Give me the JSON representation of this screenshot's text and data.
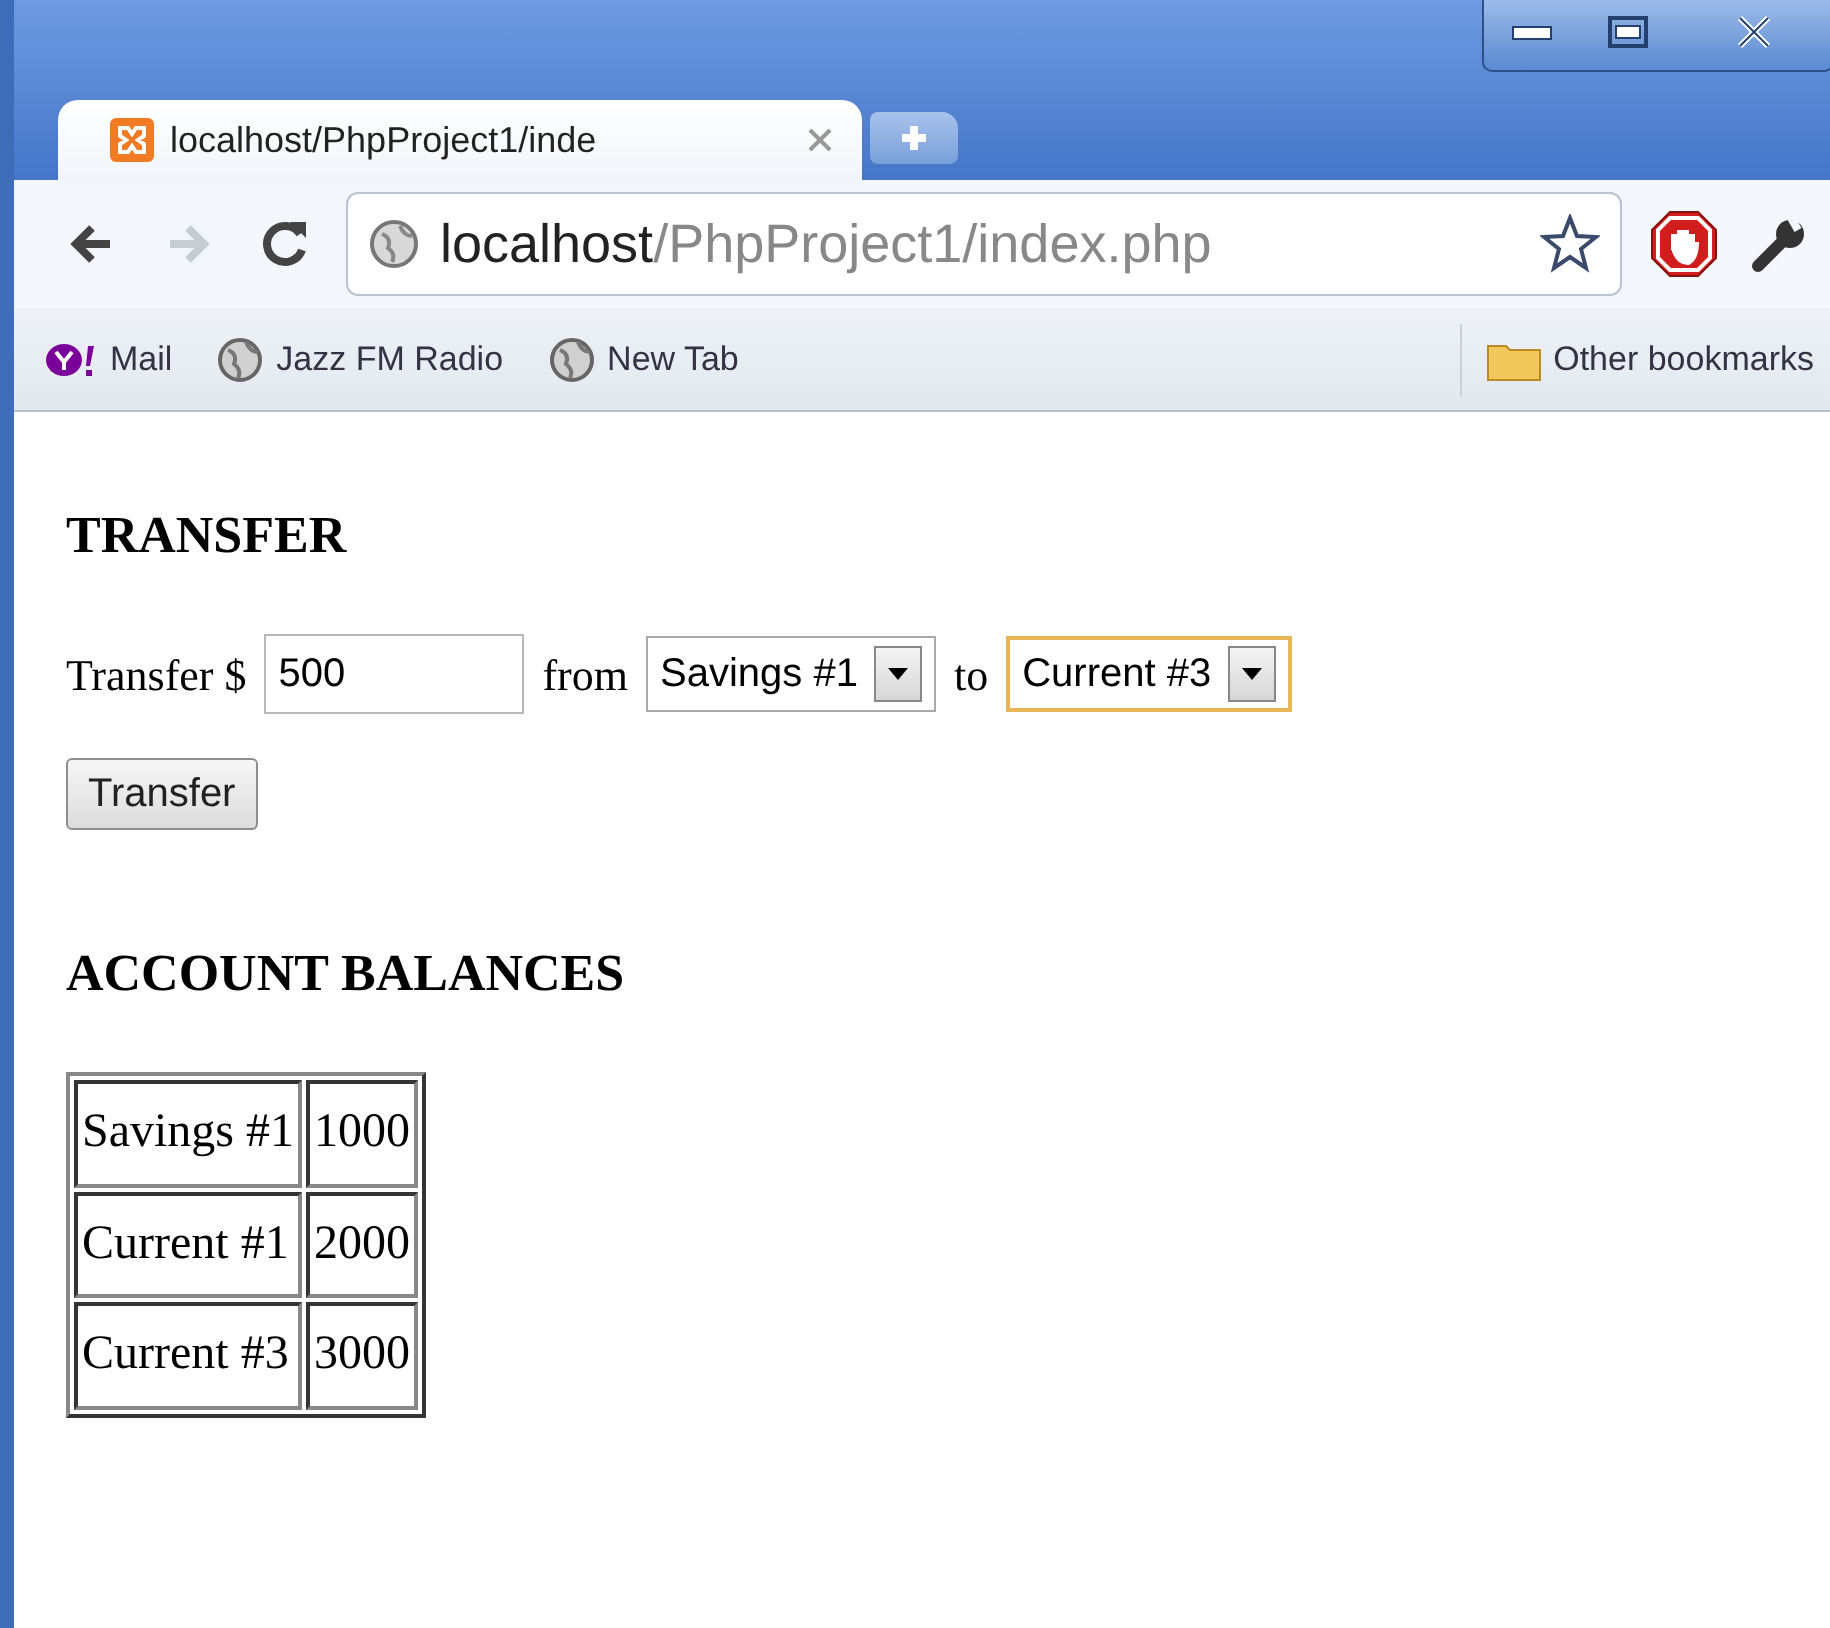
{
  "tab": {
    "title": "localhost/PhpProject1/inde",
    "selected": true
  },
  "nav_buttons": [
    {
      "kind": "back",
      "disabled": false
    },
    {
      "kind": "forward",
      "disabled": true
    },
    {
      "kind": "reload",
      "disabled": false
    }
  ],
  "address": {
    "host": "localhost",
    "path": "/PhpProject1/index.php"
  },
  "bookmarks": [
    {
      "kind": "yahoo",
      "label": "Mail"
    },
    {
      "kind": "globe",
      "label": "Jazz FM Radio"
    },
    {
      "kind": "globe",
      "label": "New Tab"
    }
  ],
  "other_bookmarks": "Other bookmarks",
  "page": {
    "heading_transfer": "TRANSFER",
    "form": {
      "prefix": "Transfer $",
      "amount": "500",
      "from_label": "from",
      "from_value": "Savings #1",
      "to_label": "to",
      "to_value": "Current #3",
      "to_focused": true,
      "button": "Transfer"
    },
    "heading_balances": "ACCOUNT BALANCES",
    "balances": [
      {
        "account": "Savings #1",
        "balance": "1000"
      },
      {
        "account": "Current #1",
        "balance": "2000"
      },
      {
        "account": "Current #3",
        "balance": "3000"
      }
    ]
  }
}
